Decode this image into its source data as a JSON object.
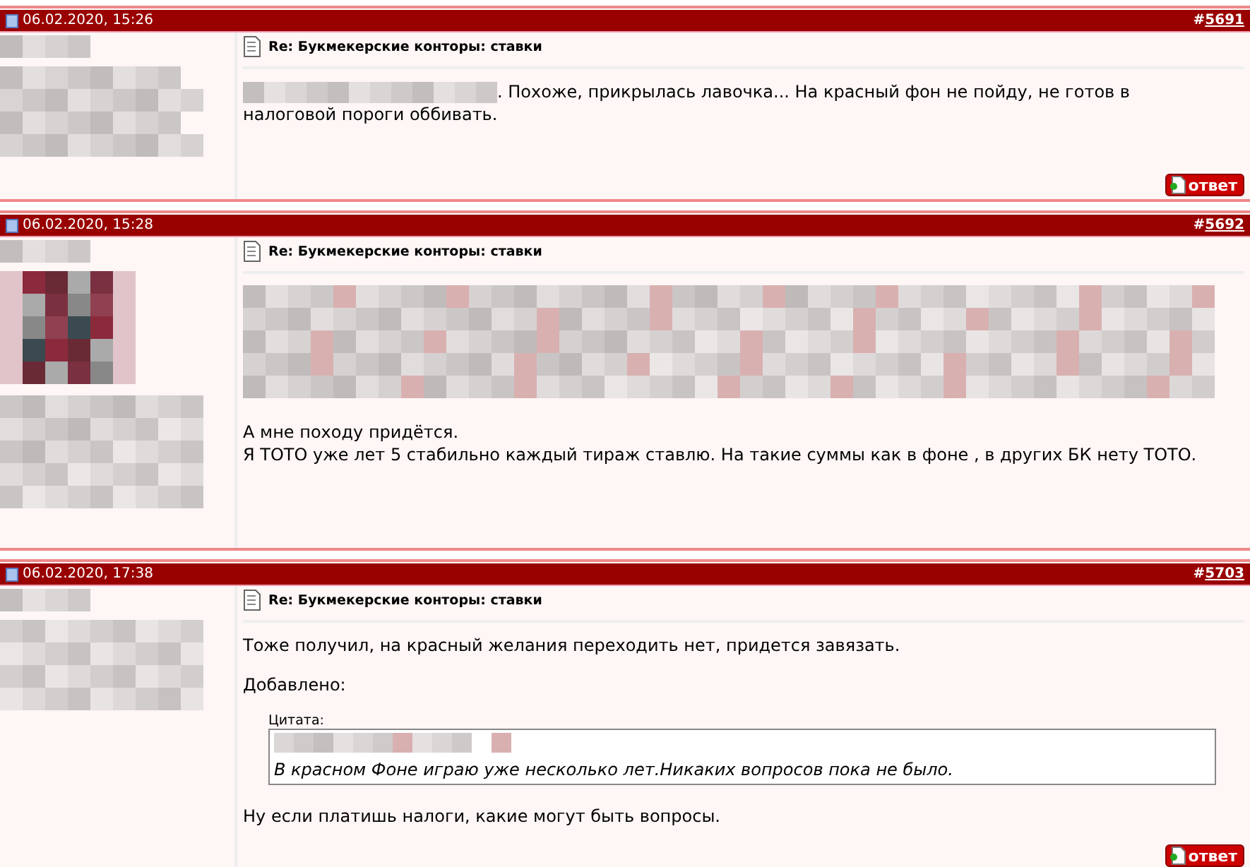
{
  "posts": [
    {
      "date": "06.02.2020, 15:26",
      "number_prefix": "#",
      "number": "5691",
      "title": "Re: Букмекерские конторы: ставки",
      "author_avatar": false,
      "blurred_quote": false,
      "body": [
        {
          "kind": "paragraph",
          "redacted_prefix": true,
          "text": ". Похоже, прикрылась лавочка... На красный фон не пойду, не готов в налоговой пороги оббивать."
        }
      ],
      "reply_label": "ответ"
    },
    {
      "date": "06.02.2020, 15:28",
      "number_prefix": "#",
      "number": "5692",
      "title": "Re: Букмекерские конторы: ставки",
      "author_avatar": true,
      "blurred_quote": true,
      "body": [
        {
          "kind": "paragraph",
          "redacted_prefix": false,
          "text": "А мне походу придётся.\nЯ ТОТО уже лет 5 стабильно каждый тираж ставлю. На такие суммы как в фоне , в других БК нету ТОТО."
        }
      ]
    },
    {
      "date": "06.02.2020, 17:38",
      "number_prefix": "#",
      "number": "5703",
      "title": "Re: Букмекерские конторы: ставки",
      "author_avatar": false,
      "blurred_quote": false,
      "body": [
        {
          "kind": "paragraph",
          "redacted_prefix": false,
          "text": "Тоже получил, на красный желания переходить нет, придется завязать."
        },
        {
          "kind": "paragraph",
          "redacted_prefix": false,
          "text": "Добавлено:"
        },
        {
          "kind": "quote",
          "label": "Цитата:",
          "text": "В красном Фоне играю уже несколько лет.Никаких вопросов пока не было."
        },
        {
          "kind": "paragraph",
          "redacted_prefix": false,
          "text": "Ну если платишь налоги, какие могут быть вопросы."
        }
      ],
      "reply_label": "ответ"
    }
  ]
}
